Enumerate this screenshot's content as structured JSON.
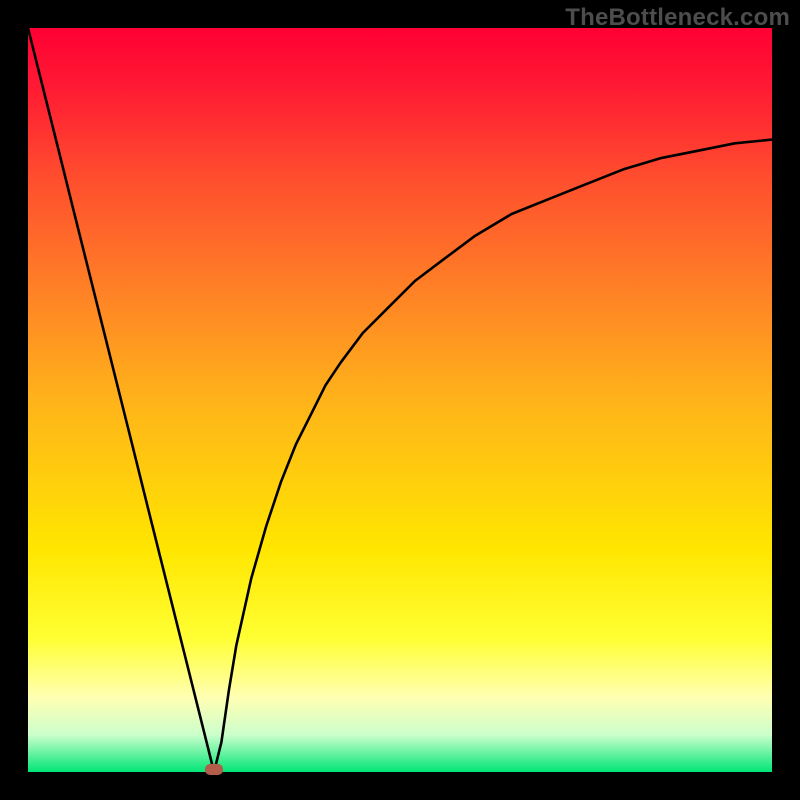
{
  "watermark": "TheBottleneck.com",
  "colors": {
    "frame_bg": "#000000",
    "curve_stroke": "#000000",
    "marker_fill": "#b25c4a",
    "gradient_top": "#ff0033",
    "gradient_bottom": "#00e676"
  },
  "chart_data": {
    "type": "line",
    "title": "",
    "xlabel": "",
    "ylabel": "",
    "xlim": [
      0,
      100
    ],
    "ylim": [
      0,
      100
    ],
    "x": [
      0,
      2,
      4,
      6,
      8,
      10,
      12,
      14,
      16,
      18,
      20,
      22,
      24,
      25,
      26,
      27,
      28,
      30,
      32,
      34,
      36,
      38,
      40,
      42,
      45,
      48,
      52,
      56,
      60,
      65,
      70,
      75,
      80,
      85,
      90,
      95,
      100
    ],
    "y": [
      100,
      92,
      84,
      76,
      68,
      60,
      52,
      44,
      36,
      28,
      20,
      12,
      4,
      0,
      4,
      11,
      17,
      26,
      33,
      39,
      44,
      48,
      52,
      55,
      59,
      62,
      66,
      69,
      72,
      75,
      77,
      79,
      81,
      82.5,
      83.5,
      84.5,
      85
    ],
    "marker": {
      "x": 25,
      "y": 0
    },
    "legend": []
  }
}
